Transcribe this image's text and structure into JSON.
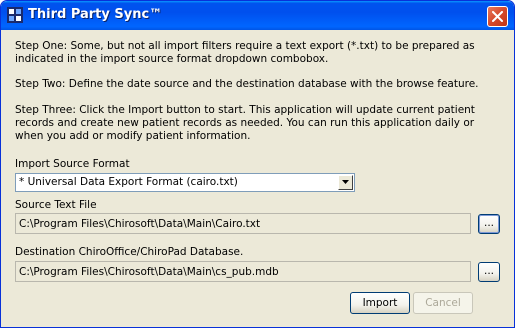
{
  "window": {
    "title": "Third Party Sync™"
  },
  "instructions": {
    "step_one": "Step One:  Some, but not all import filters require a text export (*.txt) to be prepared as indicated in the import source format dropdown combobox.",
    "step_two": "Step Two:  Define the date source and the destination database with the browse feature.",
    "step_three": "Step Three:  Click the Import button to start.  This application will update current patient records and create new patient records as needed.  You can run this application daily or when you add or modify patient information."
  },
  "import_format": {
    "label": "Import Source Format",
    "selected": "* Universal Data Export Format  (cairo.txt)"
  },
  "source_file": {
    "label": "Source Text File",
    "value": "C:\\Program Files\\Chirosoft\\Data\\Main\\Cairo.txt",
    "browse_label": "..."
  },
  "destination_db": {
    "label": "Destination ChiroOffice/ChiroPad Database.",
    "value": "C:\\Program Files\\Chirosoft\\Data\\Main\\cs_pub.mdb",
    "browse_label": "..."
  },
  "buttons": {
    "import_label": "Import",
    "cancel_label": "Cancel"
  },
  "icons": {
    "app": "app-icon",
    "close": "close-icon",
    "dropdown": "chevron-down-icon"
  }
}
